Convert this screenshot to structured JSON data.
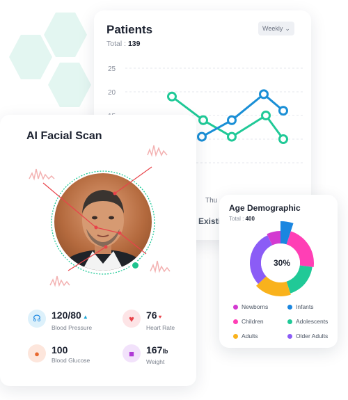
{
  "colors": {
    "teal": "#20c997",
    "blue": "#1a8fd6",
    "hex": "#e6f7f3",
    "red": "#e8434a",
    "newborns": "#d33ad1",
    "infants": "#1a86e0",
    "children": "#ff3fb5",
    "adolescents": "#20c997",
    "adults": "#f9b21c",
    "older_adults": "#8b5cf6"
  },
  "patients": {
    "title": "Patients",
    "total_label": "Total :",
    "total_value": "139",
    "period": "Weekly",
    "bottom_label": "Thu",
    "existing_label": "Existin"
  },
  "chart_data": {
    "type": "line",
    "y_ticks": [
      "25",
      "20",
      "15"
    ],
    "ylim": [
      0,
      25
    ],
    "series": [
      {
        "color": "teal",
        "values": [
          19,
          14,
          10.5,
          15,
          10
        ]
      },
      {
        "color": "blue",
        "values": [
          10.5,
          14,
          19.5,
          16
        ]
      }
    ]
  },
  "facial": {
    "title": "AI Facial Scan",
    "metrics": [
      {
        "icon": "stethoscope-icon",
        "value": "120/80",
        "label": "Blood Pressure",
        "trend": "▲"
      },
      {
        "icon": "heart-icon",
        "value": "76",
        "label": "Heart Rate",
        "trend": "♥"
      },
      {
        "icon": "drop-icon",
        "value": "100",
        "label": "Blood Glucose"
      },
      {
        "icon": "weight-scale-icon",
        "value": "167",
        "unit": "lb",
        "label": "Weight"
      }
    ]
  },
  "demographic": {
    "title": "Age Demographic",
    "total_label": "Total :",
    "total_value": "400",
    "center_label": "30%",
    "segments": [
      {
        "name": "Infants",
        "color": "infants",
        "pct": 5
      },
      {
        "name": "Children",
        "color": "children",
        "pct": 22
      },
      {
        "name": "Adolescents",
        "color": "adolescents",
        "pct": 18
      },
      {
        "name": "Adults",
        "color": "adults",
        "pct": 18
      },
      {
        "name": "Older Adults",
        "color": "older_adults",
        "pct": 30
      },
      {
        "name": "Newborns",
        "color": "newborns",
        "pct": 7
      }
    ],
    "legend": [
      "Newborns",
      "Infants",
      "Children",
      "Adolescents",
      "Adults",
      "Older Adults"
    ]
  }
}
